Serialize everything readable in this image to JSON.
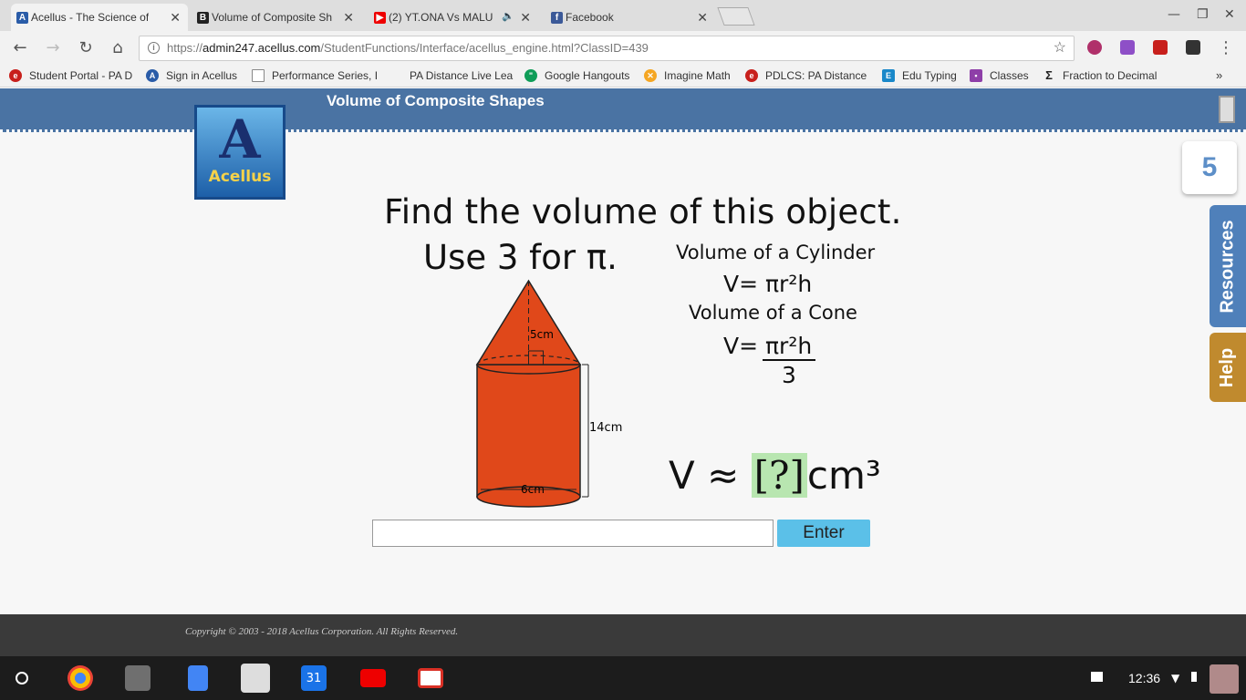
{
  "browser": {
    "tabs": [
      {
        "title": "Acellus - The Science of",
        "favicon": "acellus-icon",
        "active": true
      },
      {
        "title": "Volume of Composite Sh",
        "favicon": "b-icon",
        "active": false
      },
      {
        "title": "(2) YT.ONA Vs MALU",
        "favicon": "youtube-icon",
        "active": false
      },
      {
        "title": "Facebook",
        "favicon": "facebook-icon",
        "active": false
      }
    ],
    "url_scheme": "https://",
    "url_host": "admin247.acellus.com",
    "url_path": "/StudentFunctions/Interface/acellus_engine.html?ClassID=439",
    "bookmarks": [
      "Student Portal - PA D",
      "Sign in Acellus",
      "Performance Series, I",
      "PA Distance Live Lea",
      "Google Hangouts",
      "Imagine Math",
      "PDLCS: PA Distance",
      "Edu Typing",
      "Classes",
      "Fraction to Decimal"
    ]
  },
  "page": {
    "header_title": "Volume of Composite Shapes",
    "logo_text": "Acellus",
    "progress_count": "5",
    "resources_label": "Resources",
    "help_label": "Help",
    "question_line1": "Find the volume of this object.",
    "question_line2": "Use 3 for π.",
    "cylinder_caption": "Volume of a Cylinder",
    "cylinder_formula": "V= πr²h",
    "cone_caption": "Volume of a Cone",
    "cone_formula_num": "V= πr²h",
    "cone_formula_den": "3",
    "label_height_cone": "5cm",
    "label_height_cyl": "14cm",
    "label_diameter": "6cm",
    "answer_prefix": "V ≈ ",
    "answer_placeholder": "[?]",
    "answer_unit": "cm³",
    "input_value": "",
    "enter_label": "Enter",
    "copyright": "Copyright © 2003 - 2018 Acellus Corporation.  All Rights Reserved."
  },
  "shelf": {
    "time": "12:36"
  },
  "colors": {
    "header_blue": "#4a73a3",
    "shape_orange": "#e0481a",
    "enter_blue": "#5bc0e8",
    "answer_green": "#b8e6b0"
  }
}
